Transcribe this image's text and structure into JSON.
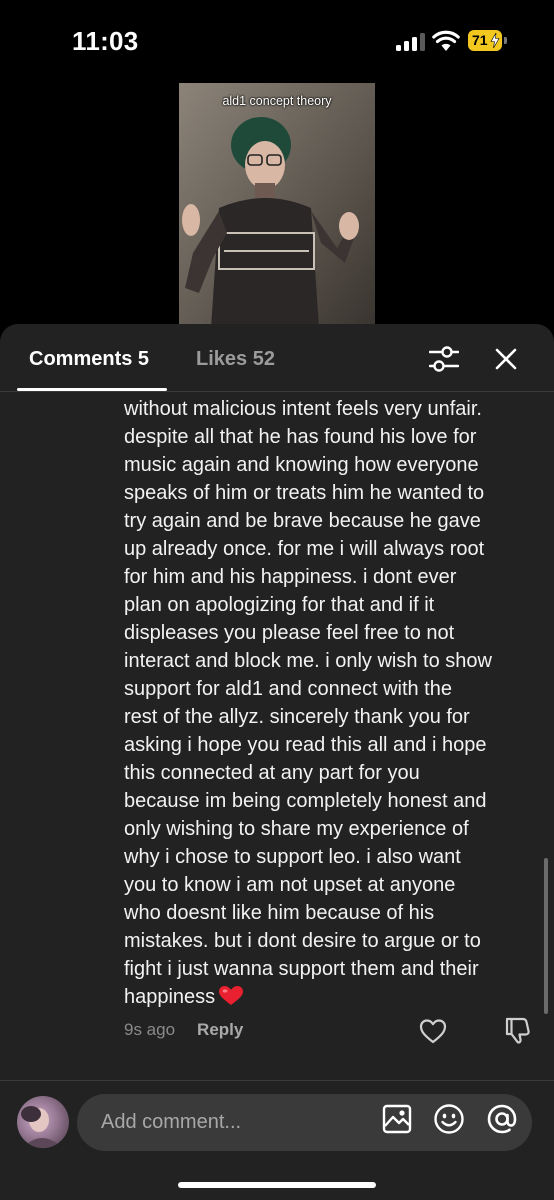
{
  "status_bar": {
    "time": "11:03",
    "battery_level": "71",
    "battery_color": "#f2c81f",
    "icons": [
      "signal-icon",
      "wifi-icon",
      "battery-icon"
    ]
  },
  "video": {
    "caption": "ald1 concept theory"
  },
  "panel": {
    "tabs": {
      "comments_label": "Comments 5",
      "likes_label": "Likes 52"
    },
    "icons": [
      "filter-icon",
      "close-icon"
    ]
  },
  "comment": {
    "lines": [
      "without malicious intent feels very unfair.",
      "despite all that he has found his love for",
      "music again and knowing how everyone",
      "speaks of him or treats him he wanted to",
      "try again and be brave because he gave",
      "up already once. for me i will always root",
      "for him and his happiness. i dont ever",
      "plan on apologizing for that and if it",
      "displeases you please feel free to not",
      "interact and block me. i only wish to show",
      "support for ald1 and connect with the",
      "rest of the allyz. sincerely thank you for",
      "asking i hope you read this all and i hope",
      "this connected at any part for you",
      "because im being completely honest and",
      "only wishing to share my experience of",
      "why i chose to support leo. i also want",
      "you to know i am not upset at anyone",
      "who doesnt like him because of his",
      "mistakes. but i dont desire to argue or to",
      "fight i just wanna support them and their",
      "happiness"
    ],
    "emoji": "red-heart-emoji",
    "timestamp": "9s ago",
    "reply_label": "Reply"
  },
  "input_bar": {
    "placeholder": "Add comment...",
    "icons": [
      "image-icon",
      "emoji-icon",
      "mention-icon"
    ]
  }
}
